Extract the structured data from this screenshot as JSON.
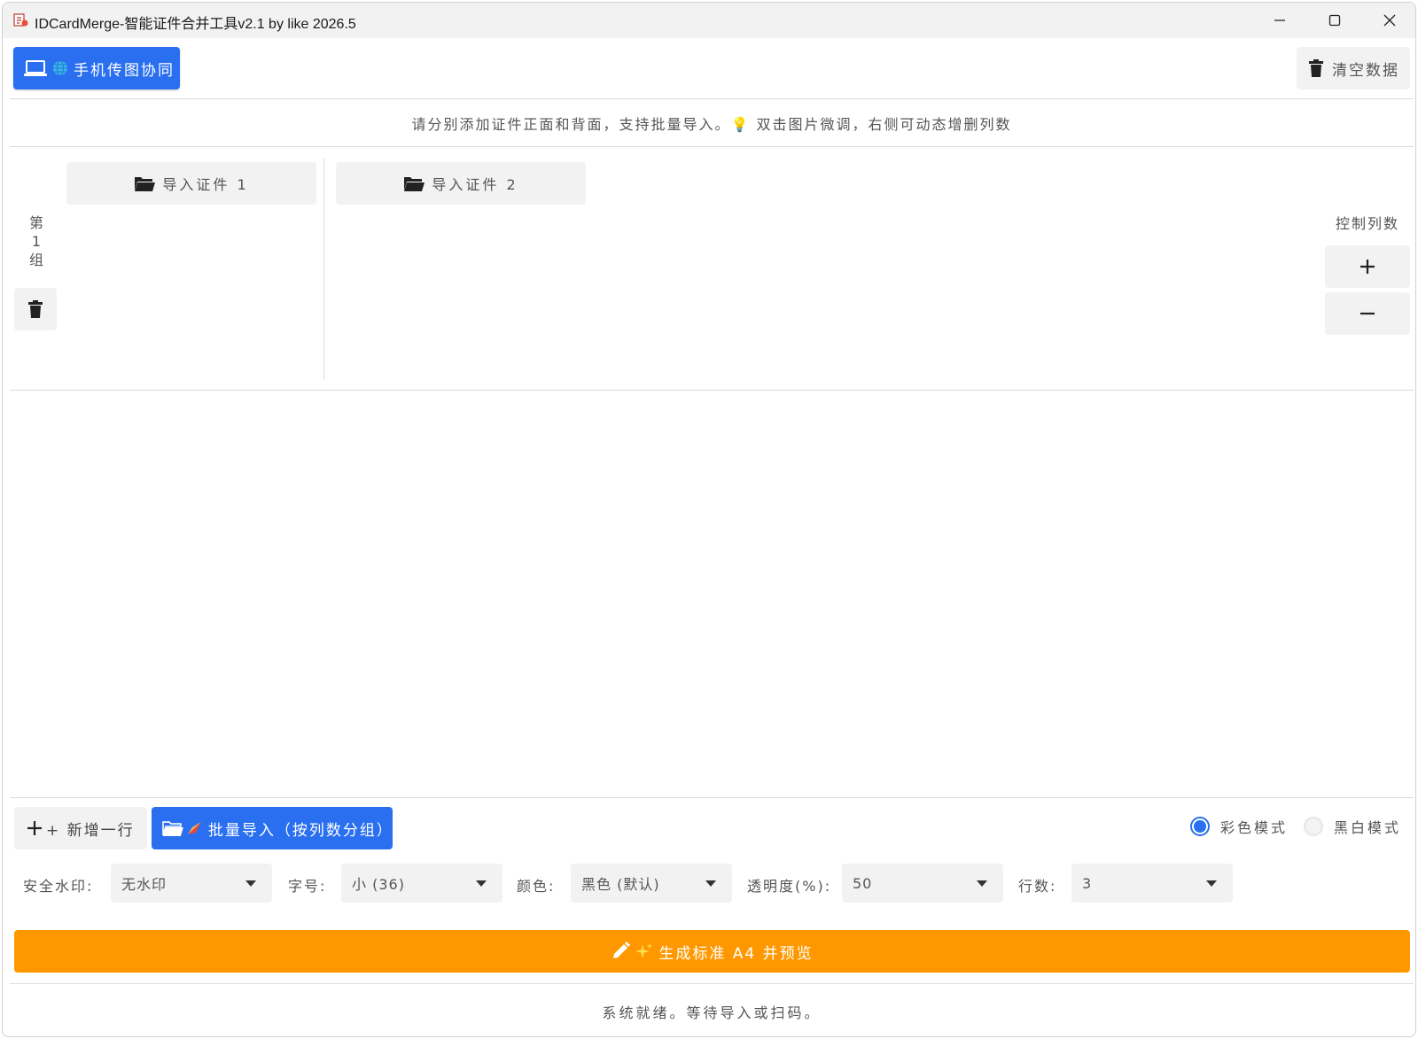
{
  "window": {
    "title": "IDCardMerge-智能证件合并工具v2.1 by like 2026.5"
  },
  "toolbar": {
    "phone_button_label": "手机传图协同",
    "clear_button_label": "清空数据"
  },
  "hint_text": "请分别添加证件正面和背面，支持批量导入。💡 双击图片微调，右侧可动态增删列数",
  "groups": [
    {
      "label_lines": [
        "第",
        "1",
        "组"
      ]
    }
  ],
  "import_buttons": [
    {
      "label": "导入证件 1"
    },
    {
      "label": "导入证件 2"
    }
  ],
  "column_control": {
    "label": "控制列数",
    "plus": "+",
    "minus": "−"
  },
  "actions": {
    "add_row_label": "+ 新增一行",
    "batch_import_label": "批量导入（按列数分组）"
  },
  "mode": {
    "options": [
      "彩色模式",
      "黑白模式"
    ],
    "selected": "彩色模式"
  },
  "settings": {
    "watermark_label": "安全水印:",
    "watermark_value": "无水印",
    "font_size_label": "字号:",
    "font_size_value": "小 (36)",
    "color_label": "颜色:",
    "color_value": "黑色 (默认)",
    "opacity_label": "透明度(%):",
    "opacity_value": "50",
    "rows_label": "行数:",
    "rows_value": "3"
  },
  "generate_button_label": "生成标准 A4 并预览",
  "status_text": "系统就绪。等待导入或扫码。",
  "colors": {
    "primary_blue": "#2a6ff0",
    "orange": "#ff9800",
    "button_gray": "#f2f2f2"
  }
}
